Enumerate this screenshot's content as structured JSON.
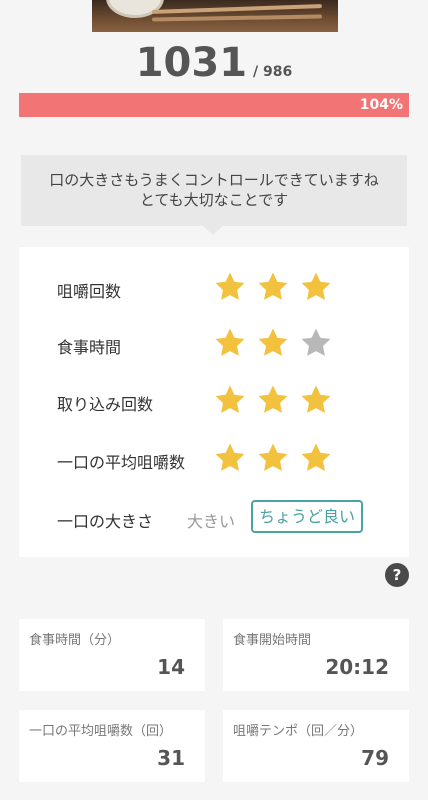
{
  "summary": {
    "count": "1031",
    "target": "/ 986",
    "percent_label": "104%",
    "progress_fraction": 1.0
  },
  "message": {
    "line1": "口の大きさもうまくコントロールできていますね",
    "line2": "とても大切なことです"
  },
  "ratings": [
    {
      "label": "咀嚼回数",
      "stars": 3
    },
    {
      "label": "食事時間",
      "stars": 2
    },
    {
      "label": "取り込み回数",
      "stars": 3
    },
    {
      "label": "一口の平均咀嚼数",
      "stars": 3
    }
  ],
  "bite_size": {
    "label": "一口の大きさ",
    "option_big": "大きい",
    "option_good": "ちょうど良い"
  },
  "help": {
    "glyph": "?"
  },
  "stats": [
    {
      "label": "食事時間（分）",
      "value": "14"
    },
    {
      "label": "食事開始時間",
      "value": "20:12"
    },
    {
      "label": "一口の平均咀嚼数（回）",
      "value": "31"
    },
    {
      "label": "咀嚼テンポ（回／分）",
      "value": "79"
    }
  ],
  "colors": {
    "star_on": "#F2C13D",
    "star_off": "#B8B8B8",
    "progress": "#F27474",
    "accent": "#4AA3A0"
  }
}
